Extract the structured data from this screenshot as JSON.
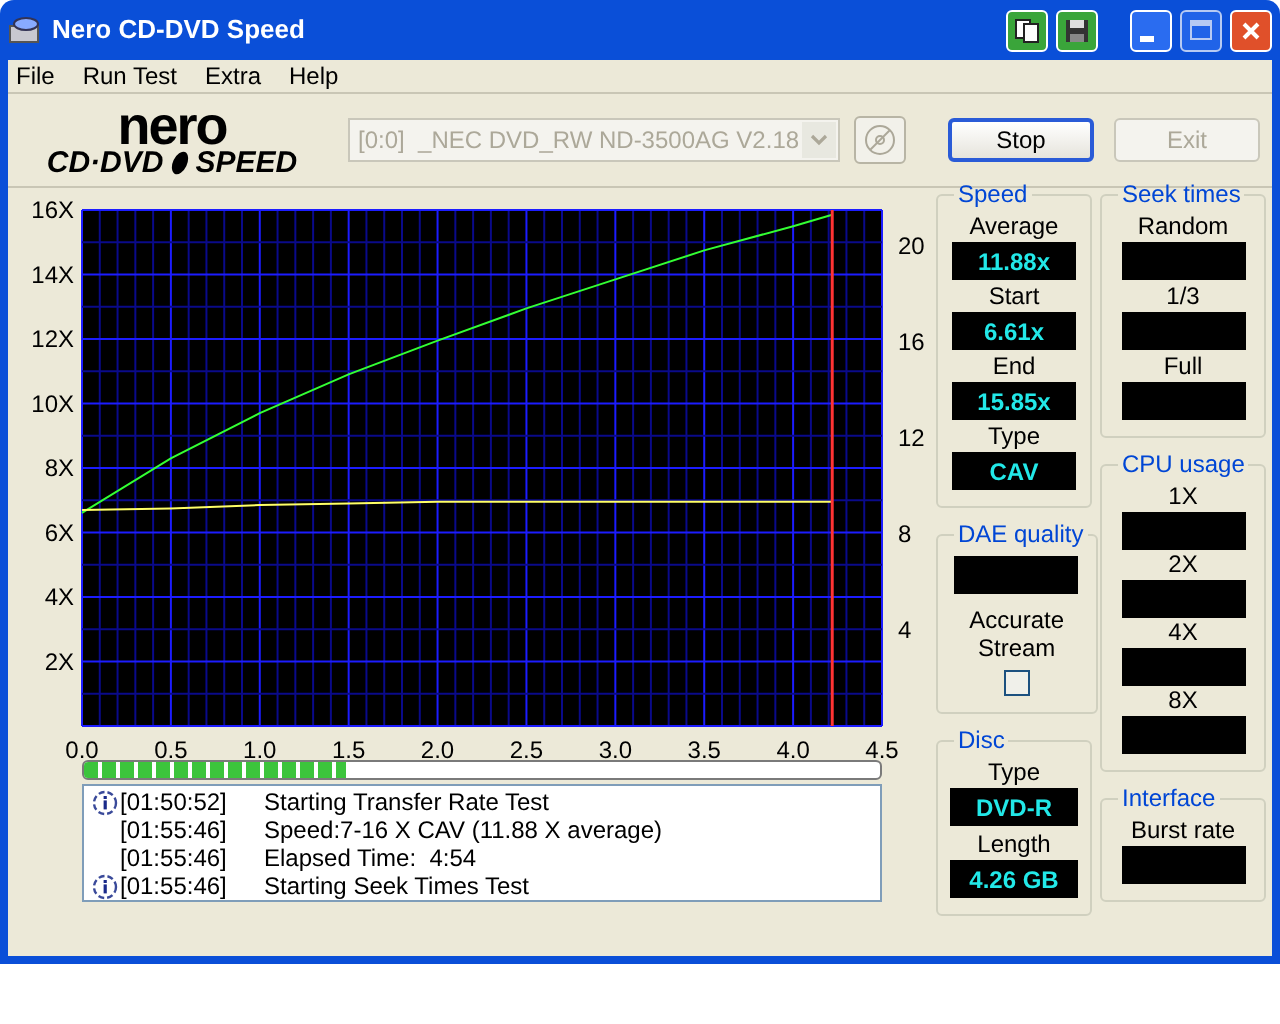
{
  "window": {
    "title": "Nero CD-DVD Speed"
  },
  "menu": [
    "File",
    "Run Test",
    "Extra",
    "Help"
  ],
  "logo": {
    "brand": "nero",
    "product": "CD·DVD",
    "product2": "SPEED"
  },
  "drive": {
    "value": "[0:0]  _NEC DVD_RW ND-3500AG V2.18",
    "disabled": true
  },
  "buttons": [
    {
      "label": "Stop",
      "disabled": false,
      "default": true
    },
    {
      "label": "Exit",
      "disabled": true,
      "default": false
    }
  ],
  "chart": {
    "chart_data": {
      "type": "line",
      "xlim": [
        0,
        4.5
      ],
      "ylim": [
        0,
        16
      ],
      "xticks": [
        {
          "value": 0,
          "label": "0.0"
        },
        {
          "value": 0.5,
          "label": "0.5"
        },
        {
          "value": 1,
          "label": "1.0"
        },
        {
          "value": 1.5,
          "label": "1.5"
        },
        {
          "value": 2,
          "label": "2.0"
        },
        {
          "value": 2.5,
          "label": "2.5"
        },
        {
          "value": 3,
          "label": "3.0"
        },
        {
          "value": 3.5,
          "label": "3.5"
        },
        {
          "value": 4,
          "label": "4.0"
        },
        {
          "value": 4.5,
          "label": "4.5"
        }
      ],
      "yticks": [
        {
          "value": 2,
          "label": "2X"
        },
        {
          "value": 4,
          "label": "4X"
        },
        {
          "value": 6,
          "label": "6X"
        },
        {
          "value": 8,
          "label": "8X"
        },
        {
          "value": 10,
          "label": "10X"
        },
        {
          "value": 12,
          "label": "12X"
        },
        {
          "value": 14,
          "label": "14X"
        },
        {
          "value": 16,
          "label": "16X"
        }
      ],
      "grid": true,
      "ref_lines": [
        {
          "axis": "x",
          "value": 4.22,
          "color": "#ff3333"
        }
      ],
      "y2lim": [
        0,
        21.5
      ],
      "y2ticks": [
        4,
        8,
        12,
        16,
        20
      ],
      "x": [
        0,
        0.5,
        1,
        1.5,
        2,
        2.5,
        3,
        3.5,
        4,
        4.22
      ],
      "series": [
        {
          "color": "#33ff33",
          "values": [
            6.61,
            8.3,
            9.7,
            10.9,
            11.95,
            12.95,
            13.85,
            14.75,
            15.5,
            15.85
          ]
        },
        {
          "color": "#ffff66",
          "values": [
            6.7,
            6.75,
            6.85,
            6.9,
            6.95,
            6.95,
            6.95,
            6.95,
            6.95,
            6.95
          ]
        }
      ]
    }
  },
  "progress": {
    "level": 0.33
  },
  "log": [
    {
      "kind": "info",
      "time": "[01:50:52]",
      "message": "Starting Transfer Rate Test"
    },
    {
      "kind": "plain",
      "time": "[01:55:46]",
      "message": "Speed:7-16 X CAV (11.88 X average)"
    },
    {
      "kind": "plain",
      "time": "[01:55:46]",
      "message": "Elapsed Time:  4:54"
    },
    {
      "kind": "info",
      "time": "[01:55:46]",
      "message": "Starting Seek Times Test"
    }
  ],
  "speed": {
    "title": "Speed",
    "items": [
      {
        "label": "Average",
        "value": "11.88x"
      },
      {
        "label": "Start",
        "value": "6.61x"
      },
      {
        "label": "End",
        "value": "15.85x"
      },
      {
        "label": "Type",
        "value": "CAV"
      }
    ]
  },
  "seek_times": {
    "title": "Seek times",
    "items": [
      {
        "label": "Random"
      },
      {
        "label": "1/3"
      },
      {
        "label": "Full"
      }
    ]
  },
  "cpu_usage": {
    "title": "CPU usage",
    "items": [
      {
        "label": "1X"
      },
      {
        "label": "2X"
      },
      {
        "label": "4X"
      },
      {
        "label": "8X"
      }
    ]
  },
  "dae_quality": {
    "title": "DAE quality",
    "accurate_stream": {
      "label": "Accurate Stream",
      "checked": false
    }
  },
  "disc": {
    "title": "Disc",
    "items": [
      {
        "label": "Type",
        "value": "DVD-R"
      },
      {
        "label": "Length",
        "value": "4.26 GB"
      }
    ]
  },
  "interface": {
    "title": "Interface",
    "items": [
      {
        "label": "Burst rate"
      }
    ]
  }
}
